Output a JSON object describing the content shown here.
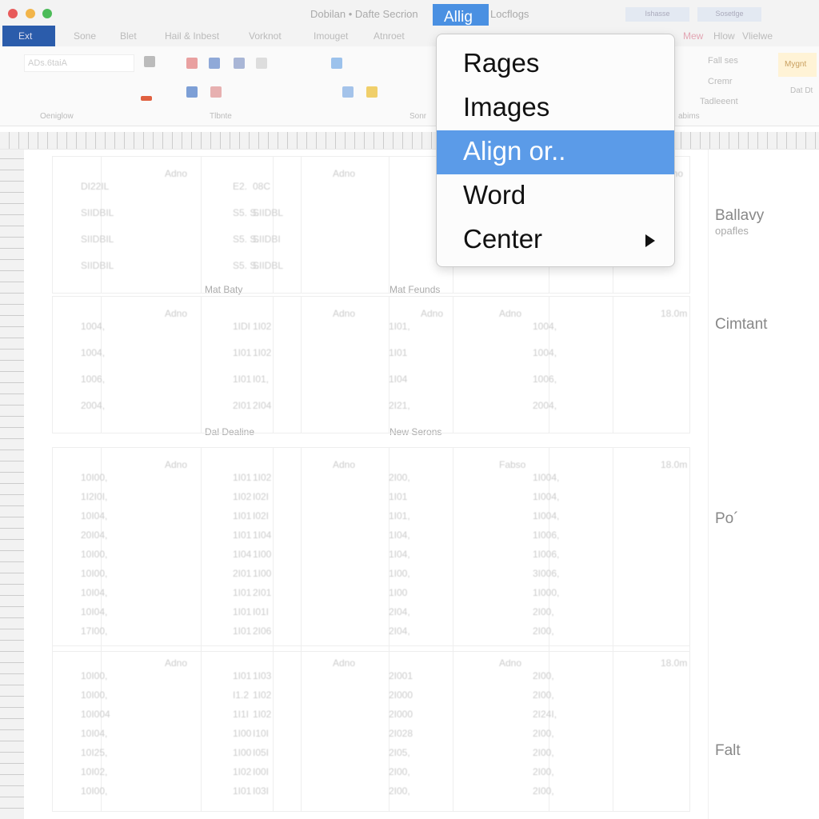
{
  "window": {
    "title": "Dobilan • Dafte Secrion",
    "active_menu": "Allig",
    "next_menu": "Locflogs",
    "buttons": [
      "Ishasse",
      "Sosetlge"
    ]
  },
  "tabs": {
    "exit": "Ext",
    "items": [
      "Sone",
      "Blet",
      "Hail & Inbest",
      "Vorknot",
      "Imouget",
      "Atnroet"
    ],
    "right": [
      "Mew",
      "Hlow",
      "Vlielwe"
    ]
  },
  "ribbon": {
    "font_value": "ADs.6taiA",
    "groups": [
      "Oeniglow",
      "Tlbnte",
      "Sonr",
      "abims"
    ],
    "right_items": [
      "Fall ses",
      "Cremr",
      "Tadleeent"
    ],
    "styles_button": "Mygnt",
    "right_label": "Dat Dt"
  },
  "menu": {
    "items": [
      {
        "label": "Rages"
      },
      {
        "label": "Images"
      },
      {
        "label": "Align or..",
        "selected": true
      },
      {
        "label": "Word"
      },
      {
        "label": "Center",
        "submenu": true
      }
    ]
  },
  "sections": [
    "Mat Baty",
    "Mat Feunds",
    "Dal Dealine",
    "New Serons"
  ],
  "table_blocks": [
    {
      "header": [
        "",
        "Adno",
        "",
        "",
        "Adno",
        "",
        "",
        "",
        "",
        "Adno"
      ],
      "rows": [
        [
          "DI22IL",
          "",
          "E2.",
          "",
          "08C",
          "",
          "",
          "",
          "",
          ""
        ],
        [
          "SIIDBIL",
          "",
          "S5. S.",
          "",
          "SIIDBL",
          "",
          "",
          "",
          "",
          ""
        ],
        [
          "SIIDBIL",
          "",
          "S5. S.",
          "",
          "SIIDBI",
          "",
          "",
          "",
          "",
          ""
        ],
        [
          "SIIDBIL",
          "",
          "S5. S.",
          "",
          "SIIDBL",
          "",
          "",
          "",
          "",
          ""
        ]
      ]
    },
    {
      "header": [
        "",
        "Adno",
        "",
        "",
        "Adno",
        "Adno",
        "",
        "Adno",
        "",
        "18.0m"
      ],
      "rows": [
        [
          "1004,",
          "",
          "1IDI",
          "",
          "1I02",
          "",
          "1I01,",
          "",
          "1004,",
          ""
        ],
        [
          "1004,",
          "",
          "1I01",
          "",
          "1I02",
          "",
          "1I01",
          "",
          "1004,",
          ""
        ],
        [
          "1006,",
          "",
          "1I01",
          "",
          "I01,",
          "",
          "1I04",
          "",
          "1006,",
          ""
        ],
        [
          "2004,",
          "",
          "2I01",
          "",
          "2I04",
          "",
          "2I21,",
          "",
          "2004,",
          ""
        ]
      ]
    },
    {
      "header": [
        "",
        "Adno",
        "",
        "",
        "Adno",
        "",
        "",
        "Fabso",
        "",
        "18.0m"
      ],
      "rows": [
        [
          "10I00,",
          "",
          "1I01",
          "",
          "1I02",
          "",
          "2I00,",
          "",
          "1I004,",
          ""
        ],
        [
          "1I2I0I,",
          "",
          "1I02",
          "",
          "I02I",
          "",
          "1I01",
          "",
          "1I004,",
          ""
        ],
        [
          "10I04,",
          "",
          "1I01",
          "",
          "I02I",
          "",
          "1I01,",
          "",
          "1I004,",
          ""
        ],
        [
          "20I04,",
          "",
          "1I01",
          "",
          "1I04",
          "",
          "1I04,",
          "",
          "1I006,",
          ""
        ],
        [
          "10I00,",
          "",
          "1I04",
          "",
          "1I00",
          "",
          "1I04,",
          "",
          "1I006,",
          ""
        ],
        [
          "10I00,",
          "",
          "2I01",
          "",
          "1I00",
          "",
          "1I00,",
          "",
          "3I006,",
          ""
        ],
        [
          "10I04,",
          "",
          "1I01",
          "",
          "2I01",
          "",
          "1I00",
          "",
          "1I000,",
          ""
        ],
        [
          "10I04,",
          "",
          "1I01",
          "",
          "I01I",
          "",
          "2I04,",
          "",
          "2I00,",
          ""
        ],
        [
          "17I00,",
          "",
          "1I01",
          "",
          "2I06",
          "",
          "2I04,",
          "",
          "2I00,",
          ""
        ]
      ]
    },
    {
      "header": [
        "",
        "Adno",
        "",
        "",
        "Adno",
        "",
        "",
        "Adno",
        "",
        "18.0m"
      ],
      "rows": [
        [
          "10I00,",
          "",
          "1I01",
          "",
          "1I03",
          "",
          "2I001",
          "",
          "2I00,",
          ""
        ],
        [
          "10I00,",
          "",
          "I1.2",
          "",
          "1I02",
          "",
          "2I000",
          "",
          "2I00,",
          ""
        ],
        [
          "10I004",
          "",
          "1I1I",
          "",
          "1I02",
          "",
          "2I000",
          "",
          "2I24I,",
          ""
        ],
        [
          "10I04,",
          "",
          "1I00",
          "",
          "I10I",
          "",
          "2I028",
          "",
          "2I00,",
          ""
        ],
        [
          "10I25,",
          "",
          "1I00",
          "",
          "I05I",
          "",
          "2I05,",
          "",
          "2I00,",
          ""
        ],
        [
          "10I02,",
          "",
          "1I02",
          "",
          "I00I",
          "",
          "2I00,",
          "",
          "2I00,",
          ""
        ],
        [
          "10I00,",
          "",
          "1I01",
          "",
          "I03I",
          "",
          "2I00,",
          "",
          "2I00,",
          ""
        ]
      ]
    }
  ],
  "sidebar": {
    "labels": [
      "Ballavy",
      "opafles",
      "Cimtant",
      "Po´",
      "Falt"
    ]
  }
}
